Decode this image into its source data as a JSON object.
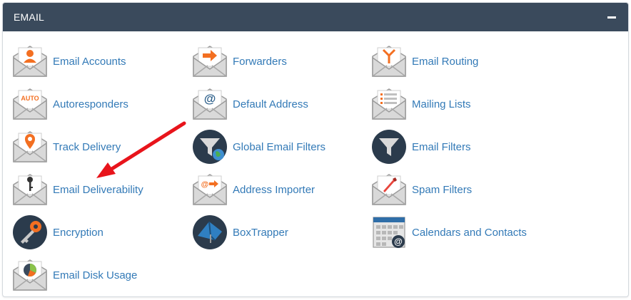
{
  "panel": {
    "title": "EMAIL",
    "collapse_icon": "minus-icon"
  },
  "colors": {
    "header_bg": "#3a4a5c",
    "link": "#337ab7",
    "icon_accent": "#f36f21",
    "annotation_arrow": "#e8141b"
  },
  "items": [
    {
      "label": "Email Accounts",
      "icon": "email-accounts-icon"
    },
    {
      "label": "Forwarders",
      "icon": "forwarders-icon"
    },
    {
      "label": "Email Routing",
      "icon": "email-routing-icon"
    },
    {
      "label": "Autoresponders",
      "icon": "autoresponders-icon"
    },
    {
      "label": "Default Address",
      "icon": "default-address-icon"
    },
    {
      "label": "Mailing Lists",
      "icon": "mailing-lists-icon"
    },
    {
      "label": "Track Delivery",
      "icon": "track-delivery-icon"
    },
    {
      "label": "Global Email Filters",
      "icon": "global-email-filters-icon"
    },
    {
      "label": "Email Filters",
      "icon": "email-filters-icon"
    },
    {
      "label": "Email Deliverability",
      "icon": "email-deliverability-icon"
    },
    {
      "label": "Address Importer",
      "icon": "address-importer-icon"
    },
    {
      "label": "Spam Filters",
      "icon": "spam-filters-icon"
    },
    {
      "label": "Encryption",
      "icon": "encryption-icon"
    },
    {
      "label": "BoxTrapper",
      "icon": "boxtrapper-icon"
    },
    {
      "label": "Calendars and Contacts",
      "icon": "calendars-contacts-icon"
    },
    {
      "label": "Email Disk Usage",
      "icon": "email-disk-usage-icon"
    }
  ],
  "auto_badge": "AUTO",
  "at_sign": "@"
}
